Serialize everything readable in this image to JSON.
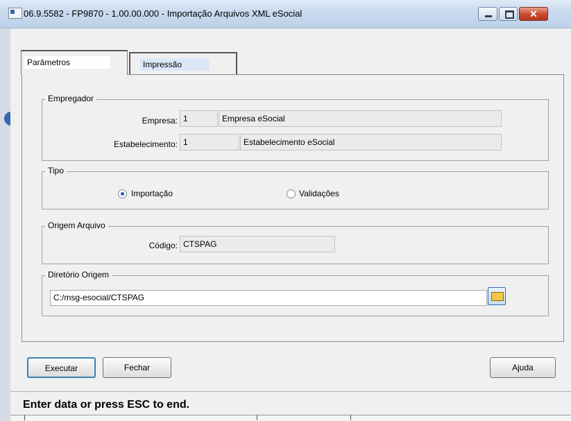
{
  "window": {
    "title": "06.9.5582 - FP9870 - 1.00.00.000 - Importação Arquivos XML eSocial",
    "close_glyph": "✕"
  },
  "tabs": [
    {
      "label": "Parâmetros"
    },
    {
      "label": "Impressão"
    }
  ],
  "empregador": {
    "legend": "Empregador",
    "empresa_label": "Empresa:",
    "empresa_code": "1",
    "empresa_name": "Empresa eSocial",
    "estab_label": "Estabelecimento:",
    "estab_code": "1",
    "estab_name": "Estabelecimento eSocial"
  },
  "tipo": {
    "legend": "Tipo",
    "options": [
      {
        "label": "Importação",
        "selected": true
      },
      {
        "label": "Validações",
        "selected": false
      }
    ]
  },
  "origem": {
    "legend": "Origem Arquivo",
    "codigo_label": "Código:",
    "codigo_value": "CTSPAG"
  },
  "diretorio": {
    "legend": "Diretório Origem",
    "path": "C:/msg-esocial/CTSPAG",
    "browse_icon": "folder-open-icon"
  },
  "buttons": {
    "executar": "Executar",
    "fechar": "Fechar",
    "ajuda": "Ajuda"
  },
  "status": "Enter data or press ESC to end."
}
